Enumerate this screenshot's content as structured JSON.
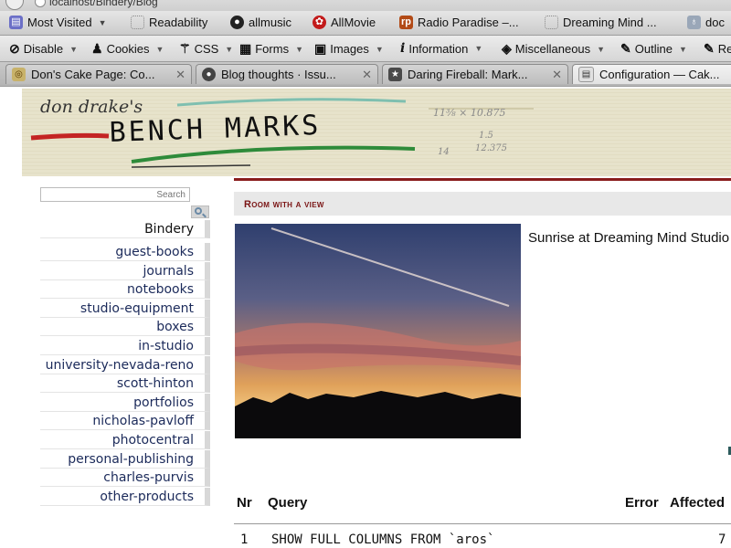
{
  "browser": {
    "url_text": "localhost/Bindery/Blog",
    "bookmarks": [
      {
        "label": "Most Visited",
        "icon": "folder-icon"
      },
      {
        "label": "Readability",
        "icon": "blank-page-icon"
      },
      {
        "label": "allmusic",
        "icon": "record-icon"
      },
      {
        "label": "AllMovie",
        "icon": "film-reel-icon"
      },
      {
        "label": "Radio Paradise –...",
        "icon": "radio-paradise-icon"
      },
      {
        "label": "Dreaming Mind ...",
        "icon": "blank-page-icon"
      },
      {
        "label": "doc",
        "icon": "bucket-icon"
      }
    ],
    "devtools": [
      {
        "label": "Disable",
        "icon": "no-icon"
      },
      {
        "label": "Cookies",
        "icon": "user-icon"
      },
      {
        "label": "CSS",
        "icon": "wand-icon"
      },
      {
        "label": "Forms",
        "icon": "form-icon"
      },
      {
        "label": "Images",
        "icon": "image-icon"
      },
      {
        "label": "Information",
        "icon": "info-icon"
      },
      {
        "label": "Miscellaneous",
        "icon": "cube-icon"
      },
      {
        "label": "Outline",
        "icon": "pencil-icon"
      },
      {
        "label": "Re",
        "icon": "pencil-icon"
      }
    ],
    "tabs": [
      {
        "label": "Don's Cake Page: Co...",
        "icon": "cake-icon",
        "active": false
      },
      {
        "label": "Blog thoughts · Issu...",
        "icon": "github-icon",
        "active": false
      },
      {
        "label": "Daring Fireball: Mark...",
        "icon": "star-icon",
        "active": false
      },
      {
        "label": "Configuration — Cak...",
        "icon": "page-icon",
        "active": true
      }
    ]
  },
  "banner": {
    "line1": "don drake's",
    "line2": "BENCH MARKS",
    "note1": "11⅜ × 10.875",
    "note2": "1.5",
    "note3": "12.375",
    "note4": "14"
  },
  "sidebar": {
    "search_placeholder": "Search",
    "heading": "Bindery",
    "items": [
      "guest-books",
      "journals",
      "notebooks",
      "studio-equipment",
      "boxes",
      "in-studio",
      "university-nevada-reno",
      "scott-hinton",
      "portfolios",
      "nicholas-pavloff",
      "photocentral",
      "personal-publishing",
      "charles-purvis",
      "other-products"
    ]
  },
  "post": {
    "section_title": "Room with a view",
    "caption": "Sunrise at Dreaming Mind Studio"
  },
  "sql_debug": {
    "headers": {
      "nr": "Nr",
      "query": "Query",
      "error": "Error",
      "affected": "Affected"
    },
    "rows": [
      {
        "nr": "1",
        "query": "SHOW FULL COLUMNS FROM `aros`",
        "affected": "7"
      }
    ]
  },
  "colors": {
    "accent": "#8a1d1d",
    "nav_link": "#1b2a5a",
    "banner_bg": "#e7e3cb"
  }
}
